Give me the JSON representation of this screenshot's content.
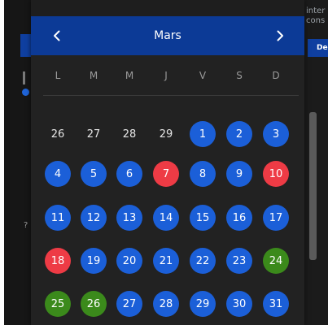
{
  "calendar": {
    "month": "Mars",
    "weekdays": [
      "L",
      "M",
      "M",
      "J",
      "V",
      "S",
      "D"
    ],
    "days": [
      {
        "label": "26",
        "status": "plain"
      },
      {
        "label": "27",
        "status": "plain"
      },
      {
        "label": "28",
        "status": "plain"
      },
      {
        "label": "29",
        "status": "plain"
      },
      {
        "label": "1",
        "status": "blue"
      },
      {
        "label": "2",
        "status": "blue"
      },
      {
        "label": "3",
        "status": "blue"
      },
      {
        "label": "4",
        "status": "blue"
      },
      {
        "label": "5",
        "status": "blue"
      },
      {
        "label": "6",
        "status": "blue"
      },
      {
        "label": "7",
        "status": "red"
      },
      {
        "label": "8",
        "status": "blue"
      },
      {
        "label": "9",
        "status": "blue"
      },
      {
        "label": "10",
        "status": "red"
      },
      {
        "label": "11",
        "status": "blue"
      },
      {
        "label": "12",
        "status": "blue"
      },
      {
        "label": "13",
        "status": "blue"
      },
      {
        "label": "14",
        "status": "blue"
      },
      {
        "label": "15",
        "status": "blue"
      },
      {
        "label": "16",
        "status": "blue"
      },
      {
        "label": "17",
        "status": "blue"
      },
      {
        "label": "18",
        "status": "red"
      },
      {
        "label": "19",
        "status": "blue"
      },
      {
        "label": "20",
        "status": "blue"
      },
      {
        "label": "21",
        "status": "blue"
      },
      {
        "label": "22",
        "status": "blue"
      },
      {
        "label": "23",
        "status": "blue"
      },
      {
        "label": "24",
        "status": "green"
      },
      {
        "label": "25",
        "status": "green"
      },
      {
        "label": "26",
        "status": "green"
      },
      {
        "label": "27",
        "status": "blue"
      },
      {
        "label": "28",
        "status": "blue"
      },
      {
        "label": "29",
        "status": "blue"
      },
      {
        "label": "30",
        "status": "blue"
      },
      {
        "label": "31",
        "status": "blue"
      }
    ],
    "colors": {
      "header": "#0c3a96",
      "blue": "#1b5fd8",
      "red": "#ee3b45",
      "green": "#3b8a1b",
      "background": "#222222"
    },
    "icons": {
      "prev": "chevron-left-icon",
      "next": "chevron-right-icon"
    }
  },
  "background_page": {
    "right_text": "inter\ncons",
    "right_button": "De"
  }
}
